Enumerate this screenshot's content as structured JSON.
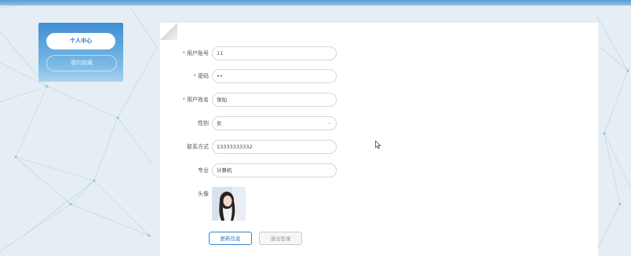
{
  "sidebar": {
    "items": [
      {
        "label": "个人中心"
      },
      {
        "label": "我的收藏"
      }
    ]
  },
  "form": {
    "fields": [
      {
        "label": "用户账号",
        "required": true,
        "value": "11"
      },
      {
        "label": "密码",
        "required": true,
        "value": "••"
      },
      {
        "label": "用户姓名",
        "required": true,
        "value": "张灿"
      },
      {
        "label": "性别",
        "required": false,
        "value": "女",
        "type": "select"
      },
      {
        "label": "联系方式",
        "required": false,
        "value": "13333333332"
      },
      {
        "label": "专业",
        "required": false,
        "value": "计算机"
      }
    ],
    "avatar_label": "头像",
    "required_mark": "*"
  },
  "buttons": {
    "update": "更新信息",
    "logout": "退出登录"
  },
  "icons": {
    "select_arrow": "chevron-down-icon"
  },
  "colors": {
    "accent": "#2f78bd",
    "required": "#e74c3c",
    "sidebar_top": "#3f8fd3",
    "background": "#e4eef4"
  }
}
